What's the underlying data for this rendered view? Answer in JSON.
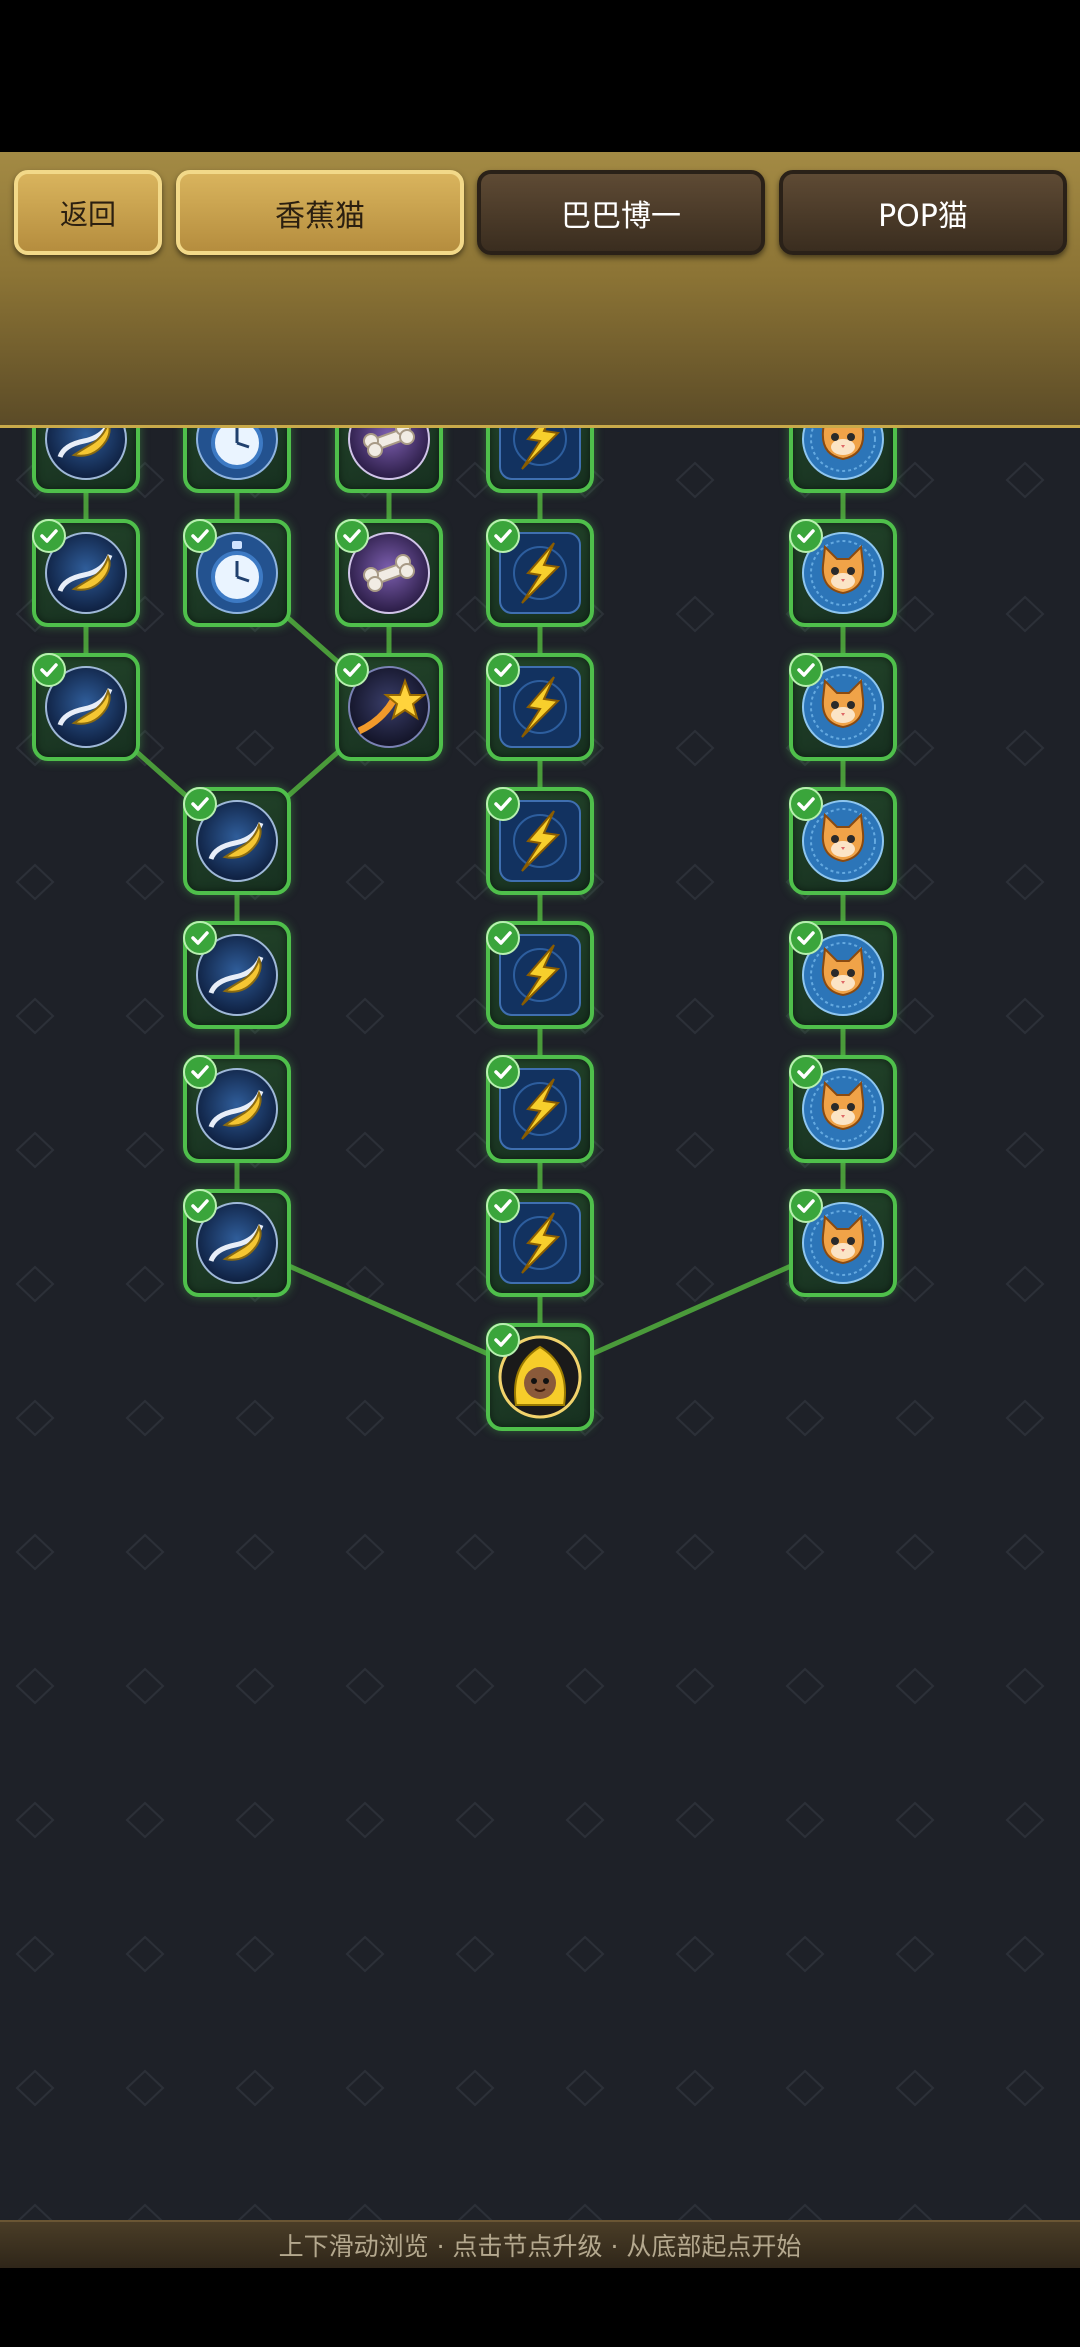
{
  "nav": {
    "back_label": "返回",
    "tabs": [
      {
        "label": "香蕉猫",
        "active": true
      },
      {
        "label": "巴巴博一",
        "active": false
      },
      {
        "label": "POP猫",
        "active": false
      }
    ]
  },
  "footer": {
    "hint": "上下滑动浏览 · 点击节点升级 · 从底部起点开始"
  },
  "colors": {
    "node_border": "#4fbf4b",
    "check": "#3aa53b",
    "gold": "#d9b45d",
    "background": "#1e2128"
  },
  "skill_tree": {
    "root": {
      "icon": "banana-cat-portrait-icon",
      "unlocked": true
    },
    "branches": [
      {
        "icons": [
          "banana-icon",
          "banana-icon",
          "banana-icon",
          "banana-icon"
        ],
        "unlocked": true
      },
      {
        "icons": [
          "lightning-bolt-icon",
          "lightning-bolt-icon",
          "lightning-bolt-icon",
          "lightning-bolt-icon",
          "lightning-bolt-icon",
          "lightning-bolt-icon",
          "lightning-bolt-icon",
          "lightning-bolt-icon",
          "lightning-bolt-icon",
          "lightning-bolt-icon",
          "lightning-bolt-icon"
        ],
        "unlocked": true
      },
      {
        "icons": [
          "cat-face-icon",
          "cat-face-icon",
          "cat-face-icon",
          "cat-face-icon",
          "cat-face-icon",
          "cat-face-icon",
          "cat-face-icon",
          "crown-icon"
        ],
        "unlocked": true
      },
      {
        "icons": [
          "banana-icon",
          "banana-icon",
          "banana-icon",
          "banana-icon",
          "banana-icon",
          "swirl-orb-icon",
          "stopwatch-icon",
          "banana-icon",
          "banana-icon"
        ],
        "unlocked": true
      },
      {
        "icons": [
          "shooting-star-icon",
          "bone-icon",
          "bone-icon",
          "bone-icon",
          "bone-icon",
          "crown-icon"
        ],
        "unlocked": true
      },
      {
        "icons": [
          "stopwatch-icon",
          "stopwatch-icon",
          "stopwatch-icon",
          "stopwatch-icon"
        ],
        "unlocked": true
      }
    ]
  }
}
